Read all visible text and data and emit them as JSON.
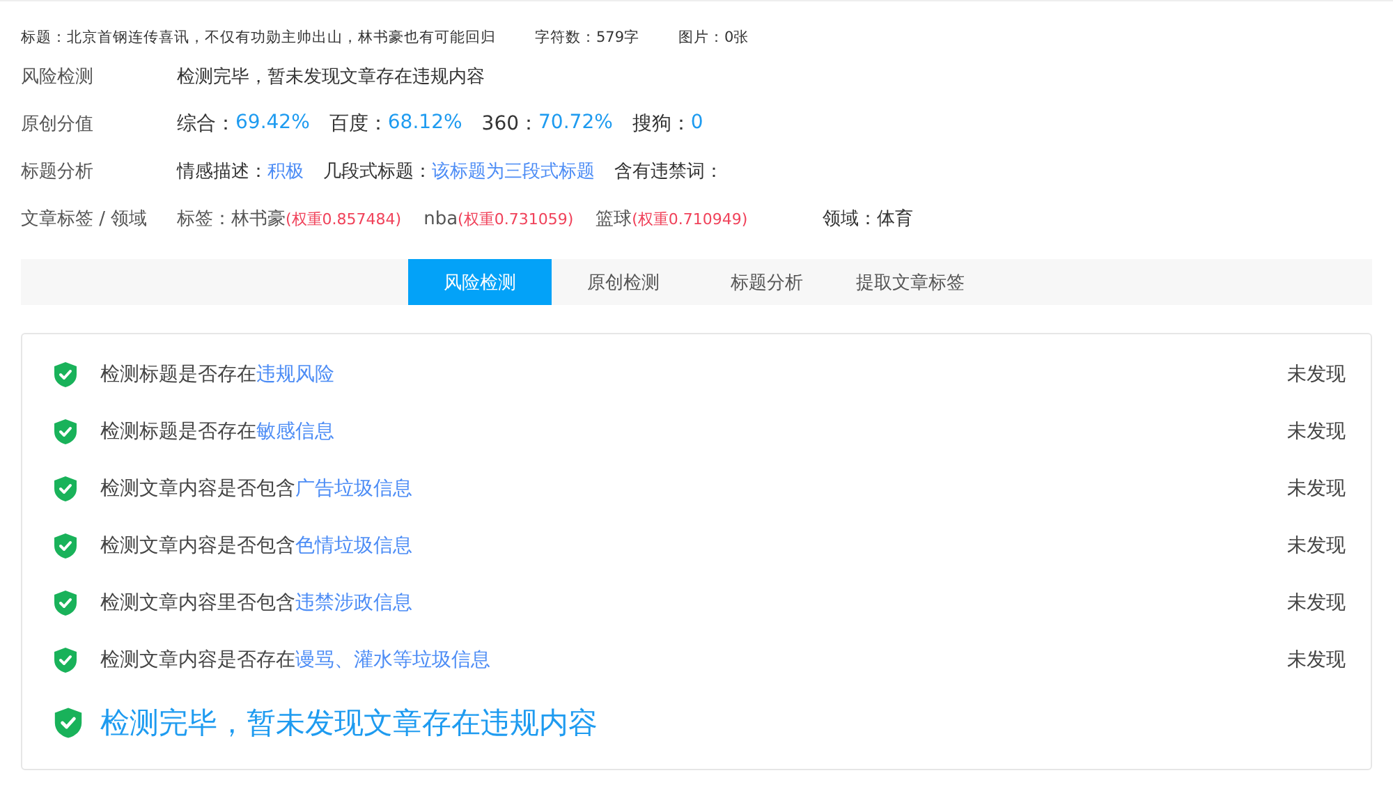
{
  "header": [
    {
      "label": "标题：北京首钢连传喜讯，不仅有功勋主帅出山，林书豪也有可能回归"
    },
    {
      "label": "字符数：579字"
    },
    {
      "label": "图片：0张"
    }
  ],
  "summary": {
    "risk": {
      "label": "风险检测",
      "value": "检测完毕，暂未发现文章存在违规内容"
    },
    "originality": {
      "label": "原创分值",
      "scores": [
        {
          "name": "综合：",
          "value": "69.42%"
        },
        {
          "name": "百度：",
          "value": "68.12%"
        },
        {
          "name": "360：",
          "value": "70.72%"
        },
        {
          "name": "搜狗：",
          "value": "0"
        }
      ]
    },
    "title_analysis": {
      "label": "标题分析",
      "items": [
        {
          "name": "情感描述：",
          "value": "积极"
        },
        {
          "name": "几段式标题：",
          "value": "该标题为三段式标题"
        },
        {
          "name": "含有违禁词："
        }
      ]
    },
    "tags": {
      "label": "文章标签 / 领域",
      "prefix": "标签：",
      "items": [
        {
          "name": "林书豪",
          "weight": "(权重0.857484)"
        },
        {
          "name": "nba",
          "weight": "(权重0.731059)"
        },
        {
          "name": "篮球",
          "weight": "(权重0.710949)"
        }
      ],
      "domain": "领域：体育"
    }
  },
  "tabs": [
    {
      "label": "风险检测",
      "selected": true
    },
    {
      "label": "原创检测",
      "selected": false
    },
    {
      "label": "标题分析",
      "selected": false
    },
    {
      "label": "提取文章标签",
      "selected": false
    }
  ],
  "checks": [
    {
      "text": "检测标题是否存在",
      "highlight": "违规风险",
      "result": "未发现"
    },
    {
      "text": "检测标题是否存在",
      "highlight": "敏感信息",
      "result": "未发现"
    },
    {
      "text": "检测文章内容是否包含",
      "highlight": "广告垃圾信息",
      "result": "未发现"
    },
    {
      "text": "检测文章内容是否包含",
      "highlight": "色情垃圾信息",
      "result": "未发现"
    },
    {
      "text": "检测文章内容里否包含",
      "highlight": "违禁涉政信息",
      "result": "未发现"
    },
    {
      "text": "检测文章内容是否存在",
      "highlight": "谩骂、灌水等垃圾信息",
      "result": "未发现"
    }
  ],
  "conclusion": "检测完毕，暂未发现文章存在违规内容"
}
